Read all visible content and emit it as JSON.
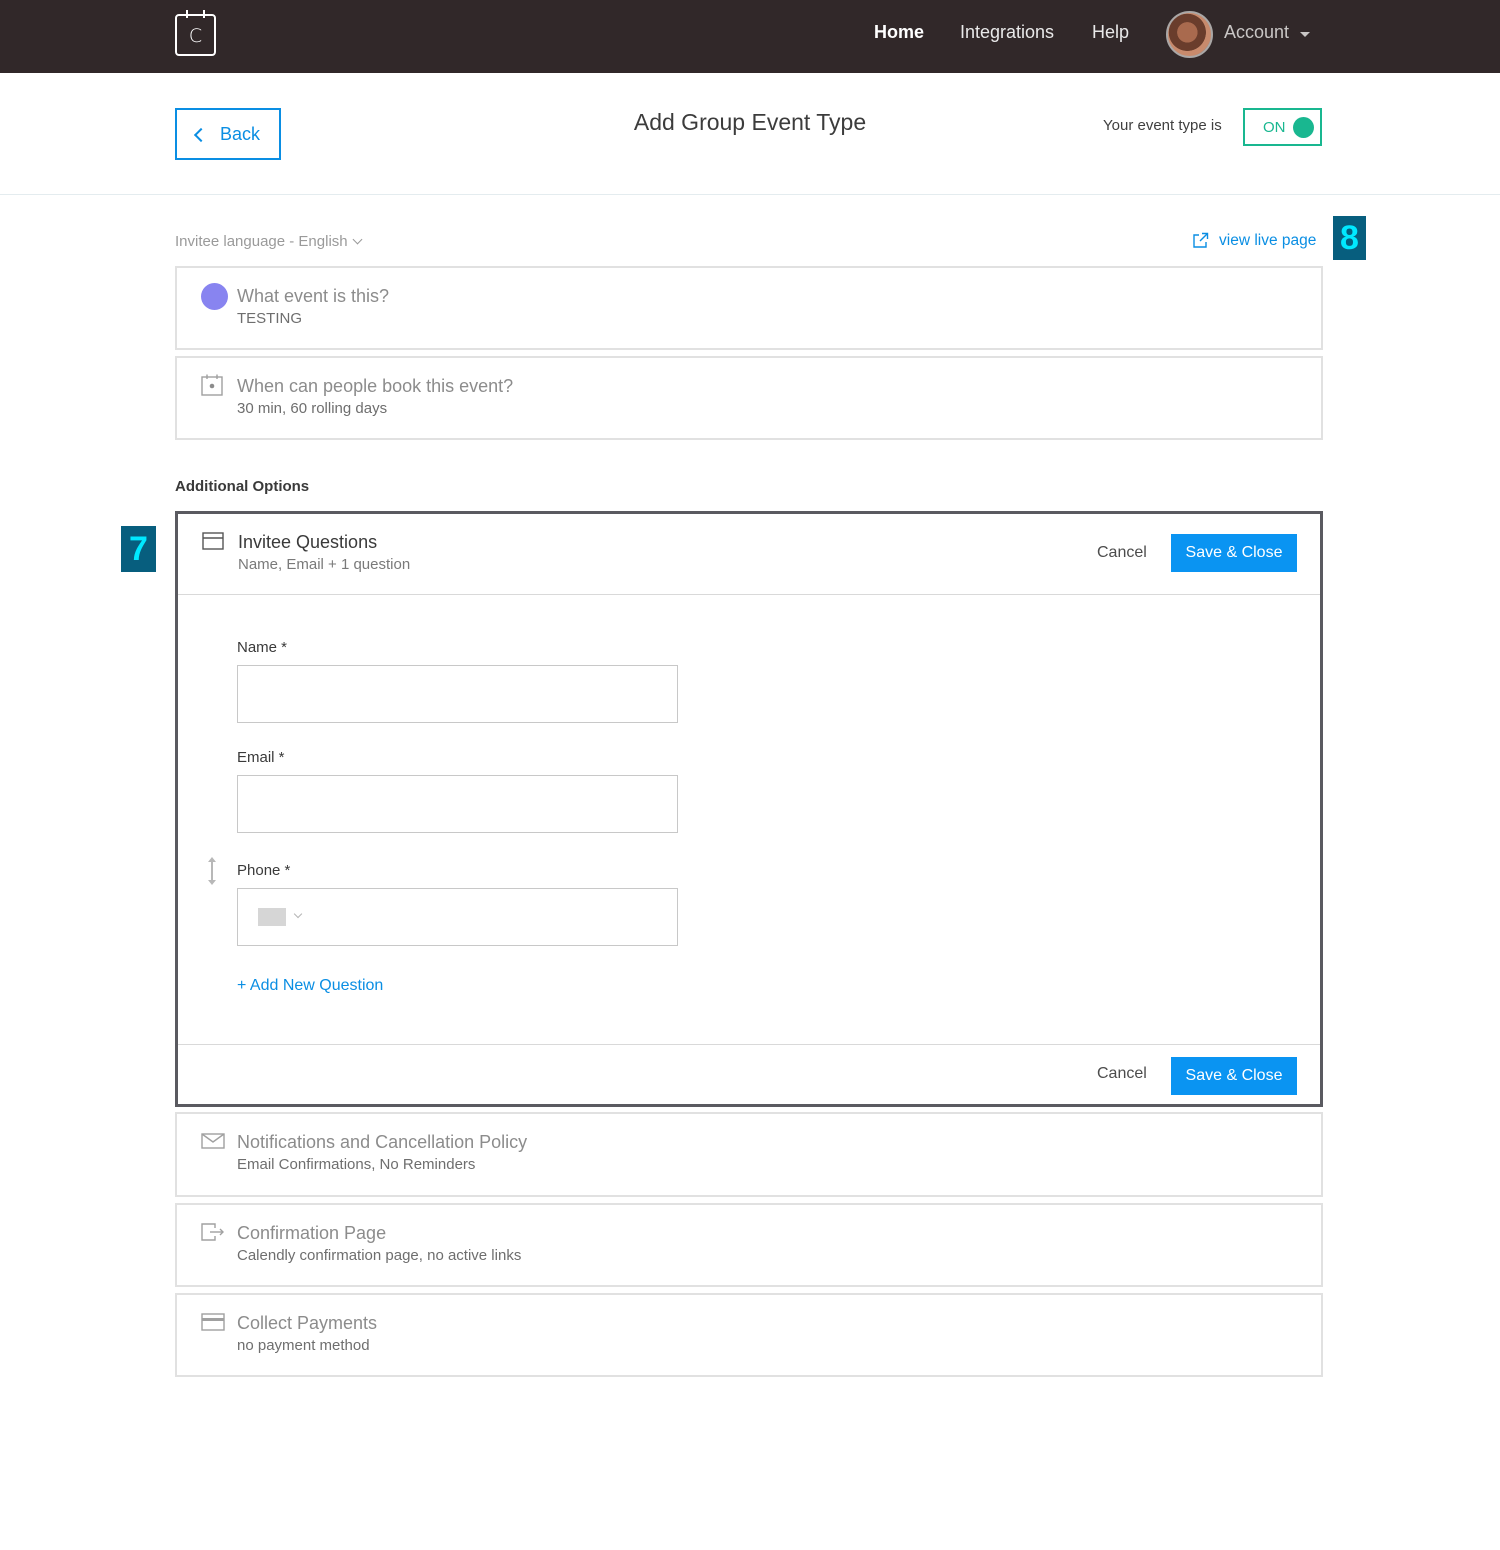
{
  "nav": {
    "logo_letter": "C",
    "links": [
      "Home",
      "Integrations",
      "Help"
    ],
    "account_label": "Account"
  },
  "header": {
    "back_label": "Back",
    "title": "Add Group Event Type",
    "status_label": "Your event type is",
    "toggle_label": "ON"
  },
  "toolbar": {
    "language": "Invitee language - English",
    "view_live": "view live page"
  },
  "markers": {
    "seven": "7",
    "eight": "8"
  },
  "cards": {
    "what": {
      "title": "What event is this?",
      "subtitle": "TESTING",
      "icon": "color-dot-icon",
      "color": "#8884f0"
    },
    "when": {
      "title": "When can people book this event?",
      "subtitle": "30 min, 60 rolling days",
      "icon": "calendar-icon"
    }
  },
  "additional_options": {
    "heading": "Additional Options",
    "invitee_questions": {
      "title": "Invitee Questions",
      "subtitle": "Name, Email + 1 question",
      "cancel": "Cancel",
      "save": "Save & Close",
      "fields": [
        {
          "label": "Name *",
          "value": ""
        },
        {
          "label": "Email *",
          "value": ""
        },
        {
          "label": "Phone *",
          "value": ""
        }
      ],
      "add_question": "+ Add New Question"
    },
    "notifications": {
      "title": "Notifications and Cancellation Policy",
      "subtitle": "Email Confirmations, No Reminders",
      "icon": "envelope-icon"
    },
    "confirmation": {
      "title": "Confirmation Page",
      "subtitle": "Calendly confirmation page, no active links",
      "icon": "exit-arrow-icon"
    },
    "payments": {
      "title": "Collect Payments",
      "subtitle": "no payment method",
      "icon": "credit-card-icon"
    }
  },
  "colors": {
    "brand_blue": "#0a8ee3",
    "toggle_green": "#19b790",
    "nav_bg": "#312829"
  }
}
